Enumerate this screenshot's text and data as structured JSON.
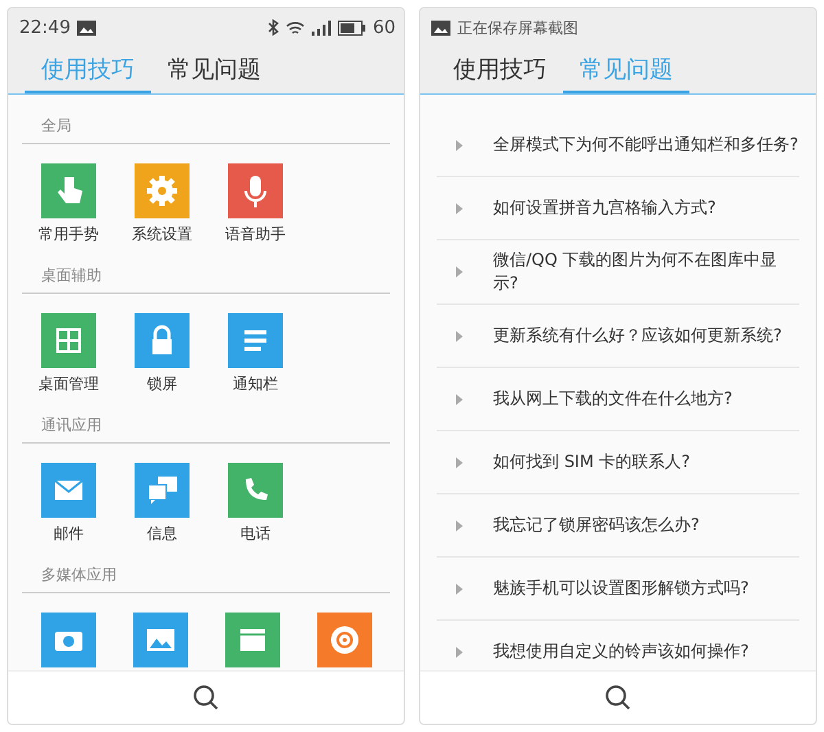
{
  "panels": [
    {
      "status_bar": {
        "time": "22:49",
        "battery": "60"
      },
      "tabs": [
        {
          "label": "使用技巧",
          "selected": true
        },
        {
          "label": "常见问题",
          "selected": false
        }
      ],
      "sections": [
        {
          "title": "全局",
          "items": [
            {
              "label": "常用手势",
              "kind": "hand",
              "color": "#43b36a"
            },
            {
              "label": "系统设置",
              "kind": "gear",
              "color": "#f0a41c"
            },
            {
              "label": "语音助手",
              "kind": "mic",
              "color": "#e65a4c"
            }
          ]
        },
        {
          "title": "桌面辅助",
          "items": [
            {
              "label": "桌面管理",
              "kind": "grid",
              "color": "#43b36a"
            },
            {
              "label": "锁屏",
              "kind": "lock",
              "color": "#2fa3e6"
            },
            {
              "label": "通知栏",
              "kind": "lines",
              "color": "#2fa3e6"
            }
          ]
        },
        {
          "title": "通讯应用",
          "items": [
            {
              "label": "邮件",
              "kind": "mail",
              "color": "#2fa3e6"
            },
            {
              "label": "信息",
              "kind": "chat",
              "color": "#2fa3e6"
            },
            {
              "label": "电话",
              "kind": "phone",
              "color": "#43b36a"
            }
          ]
        },
        {
          "title": "多媒体应用",
          "items": [
            {
              "kind": "camera",
              "color": "#2fa3e6"
            },
            {
              "kind": "image",
              "color": "#2fa3e6"
            },
            {
              "kind": "film",
              "color": "#43b36a"
            },
            {
              "kind": "disc",
              "color": "#f57a2a"
            }
          ]
        }
      ]
    },
    {
      "status_bar": {
        "notification": "正在保存屏幕截图"
      },
      "tabs": [
        {
          "label": "使用技巧",
          "selected": false
        },
        {
          "label": "常见问题",
          "selected": true
        }
      ],
      "questions": [
        "全屏模式下为何不能呼出通知栏和多任务?",
        "如何设置拼音九宫格输入方式?",
        "微信/QQ 下载的图片为何不在图库中显示?",
        "更新系统有什么好？应该如何更新系统?",
        "我从网上下载的文件在什么地方?",
        "如何找到 SIM 卡的联系人?",
        "我忘记了锁屏密码该怎么办?",
        "魅族手机可以设置图形解锁方式吗?",
        "我想使用自定义的铃声该如何操作?"
      ]
    }
  ]
}
